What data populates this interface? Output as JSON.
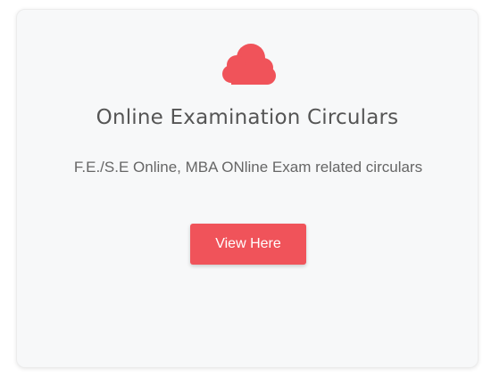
{
  "card": {
    "icon": "cloud-icon",
    "accent_color": "#f0535a",
    "title": "Online Examination Circulars",
    "description": "F.E./S.E Online, MBA ONline Exam related circulars",
    "button_label": "View Here"
  }
}
